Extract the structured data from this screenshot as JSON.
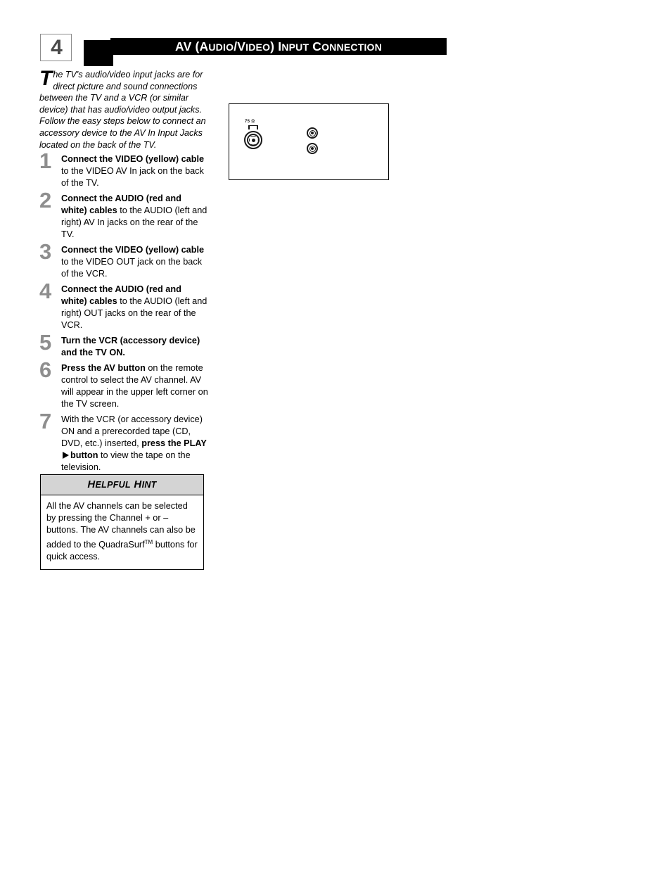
{
  "header": {
    "step_number": "4",
    "title_main": "AV (A",
    "title_full": "AV (AUDIO/VIDEO) INPUT CONNECTION",
    "parts": [
      {
        "text": "AV (A",
        "small": false
      },
      {
        "text": "UDIO",
        "small": true
      },
      {
        "text": "/V",
        "small": false
      },
      {
        "text": "IDEO",
        "small": true
      },
      {
        "text": ") I",
        "small": false
      },
      {
        "text": "NPUT",
        "small": true
      },
      {
        "text": " C",
        "small": false
      },
      {
        "text": "ONNECTION",
        "small": true
      }
    ]
  },
  "intro": {
    "dropcap": "T",
    "text": "he TV's audio/video input jacks are for direct picture and sound connections between the TV and a VCR (or similar device) that has audio/video output jacks. Follow the easy steps below to connect an accessory device to the AV In Input Jacks located on the back of the TV."
  },
  "steps": [
    {
      "number": "1",
      "bold_lead": "Connect the VIDEO (yellow) cable",
      "rest": " to the VIDEO  AV In jack on the back of the TV."
    },
    {
      "number": "2",
      "bold_lead": "Connect the AUDIO (red and white) cables",
      "rest": " to the AUDIO (left and right)  AV In jacks on the rear of the TV."
    },
    {
      "number": "3",
      "bold_lead": "Connect the VIDEO (yellow) cable",
      "rest": " to the VIDEO OUT jack on the back of the VCR."
    },
    {
      "number": "4",
      "bold_lead": "Connect the AUDIO (red and white) cables",
      "rest": " to the AUDIO (left and right) OUT jacks on the rear of the VCR."
    },
    {
      "number": "5",
      "bold_lead": "Turn the VCR (accessory device) and the TV ON.",
      "rest": ""
    },
    {
      "number": "6",
      "bold_lead": "Press the AV button",
      "rest": " on the remote control to select the AV channel. AV will appear in the upper left corner on the TV screen."
    },
    {
      "number": "7",
      "lead": "With the VCR (or accessory device) ON and a prerecorded tape (CD, DVD, etc.) inserted, ",
      "bold_mid": "press the PLAY",
      "bold_after": "button",
      "rest": " to view the tape on the television."
    }
  ],
  "hint": {
    "title_parts": [
      {
        "text": "H",
        "small": false
      },
      {
        "text": "ELPFUL",
        "small": true
      },
      {
        "text": " H",
        "small": false
      },
      {
        "text": "INT",
        "small": true
      }
    ],
    "title": "HELPFUL HINT",
    "body_1": "All the AV channels can be selected by pressing the Channel + or – buttons. The AV channels can also be added to the QuadraSurf",
    "trademark": "TM",
    "body_2": " buttons for quick access."
  },
  "diagram": {
    "antenna_label": "75 Ω",
    "jack_names": [
      "coax-antenna-jack",
      "rca-jack-top",
      "rca-jack-bottom"
    ]
  },
  "colors": {
    "header_bar": "#000000",
    "step_number": "#8e8e8e",
    "hint_header_bg": "#d4d4d4",
    "text": "#000000"
  }
}
